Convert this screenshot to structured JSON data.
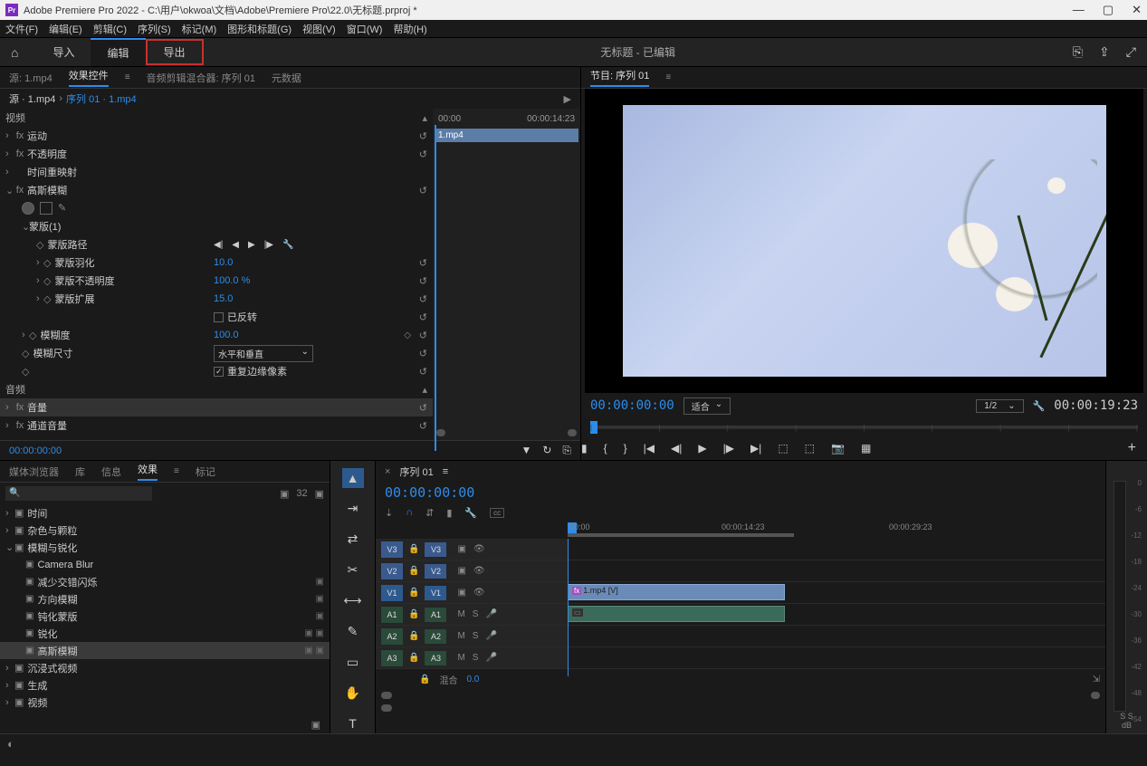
{
  "titlebar": {
    "app_badge": "Pr",
    "title": "Adobe Premiere Pro 2022 - C:\\用户\\okwoa\\文档\\Adobe\\Premiere Pro\\22.0\\无标题.prproj *"
  },
  "menubar": [
    "文件(F)",
    "编辑(E)",
    "剪辑(C)",
    "序列(S)",
    "标记(M)",
    "图形和标题(G)",
    "视图(V)",
    "窗口(W)",
    "帮助(H)"
  ],
  "modebar": {
    "modes": [
      "导入",
      "编辑",
      "导出"
    ],
    "active_index": 1,
    "highlight_index": 2,
    "center": "无标题 - 已编辑"
  },
  "source_tabs": {
    "source": "源: 1.mp4",
    "fx": "效果控件",
    "mixer": "音频剪辑混合器: 序列 01",
    "meta": "元数据"
  },
  "crumb": {
    "src": "源 · 1.mp4",
    "seq": "序列 01 · 1.mp4"
  },
  "fx_tc": {
    "start": "00:00",
    "end": "00:00:14:23"
  },
  "clip_label": "1.mp4",
  "fx": {
    "video": "视频",
    "motion": "运动",
    "opacity": "不透明度",
    "timeremap": "时间重映射",
    "gauss": "高斯模糊",
    "mask": "蒙版(1)",
    "mask_path": "蒙版路径",
    "mask_feather": "蒙版羽化",
    "mask_feather_val": "10.0",
    "mask_opacity": "蒙版不透明度",
    "mask_opacity_val": "100.0 %",
    "mask_expand": "蒙版扩展",
    "mask_expand_val": "15.0",
    "inverted": "已反转",
    "blur": "模糊度",
    "blur_val": "100.0",
    "blur_dim": "模糊尺寸",
    "blur_dim_val": "水平和垂直",
    "repeat_edge": "重复边缘像素",
    "audio": "音频",
    "volume": "音量",
    "ch_volume": "通道音量"
  },
  "fx_footer_tc": "00:00:00:00",
  "program": {
    "tab": "节目: 序列 01",
    "tc_in": "00:00:00:00",
    "fit": "适合",
    "res": "1/2",
    "tc_out": "00:00:19:23"
  },
  "effects_tabs": [
    "媒体浏览器",
    "库",
    "信息",
    "效果",
    "标记"
  ],
  "effects_active": 3,
  "effects_tree": {
    "time": "时间",
    "noise": "杂色与颗粒",
    "blur_folder": "模糊与锐化",
    "camera_blur": "Camera Blur",
    "reduce": "减少交错闪烁",
    "dir_blur": "方向模糊",
    "unsharp": "钝化蒙版",
    "sharpen": "锐化",
    "gauss": "高斯模糊",
    "immersive": "沉浸式视频",
    "generate": "生成",
    "video": "视频"
  },
  "timeline": {
    "tab": "序列 01",
    "tc": "00:00:00:00",
    "ruler": {
      "m0": "00:00",
      "m1": "00:00:14:23",
      "m2": "00:00:29:23"
    },
    "tracks": {
      "v3": "V3",
      "v2": "V2",
      "v1": "V1",
      "a1": "A1",
      "a2": "A2",
      "a3": "A3"
    },
    "clip_v1": "1.mp4 [V]",
    "fx_badge": "fx",
    "mix": "混合",
    "mix_val": "0.0",
    "m": "M",
    "s": "S"
  },
  "meter": {
    "marks": [
      "0",
      "-6",
      "-12",
      "-18",
      "-24",
      "-30",
      "-36",
      "-42",
      "-48",
      "-54"
    ],
    "db": "dB",
    "ss": "S  S"
  }
}
